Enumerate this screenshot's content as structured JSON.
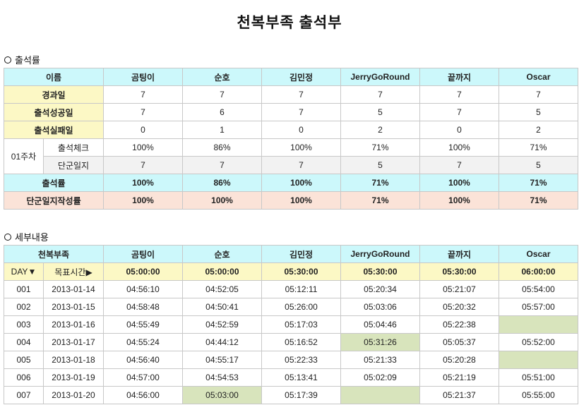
{
  "title": "천복부족 출석부",
  "summary": {
    "section_title": "출석률",
    "name_label": "이름",
    "members": [
      "곰팅이",
      "순호",
      "김민정",
      "JerryGoRound",
      "끝까지",
      "Oscar"
    ],
    "elapsed_label": "경과일",
    "elapsed": [
      "7",
      "7",
      "7",
      "7",
      "7",
      "7"
    ],
    "success_label": "출석성공일",
    "success": [
      "7",
      "6",
      "7",
      "5",
      "7",
      "5"
    ],
    "fail_label": "출석실패일",
    "fail": [
      "0",
      "1",
      "0",
      "2",
      "0",
      "2"
    ],
    "week_label": "01주차",
    "check_label": "출석체크",
    "check": [
      "100%",
      "86%",
      "100%",
      "71%",
      "100%",
      "71%"
    ],
    "diary_label": "단군일지",
    "diary": [
      "7",
      "7",
      "7",
      "5",
      "7",
      "5"
    ],
    "rate_label": "출석률",
    "rate": [
      "100%",
      "86%",
      "100%",
      "71%",
      "100%",
      "71%"
    ],
    "diary_rate_label": "단군일지작성률",
    "diary_rate": [
      "100%",
      "100%",
      "100%",
      "71%",
      "100%",
      "71%"
    ]
  },
  "detail": {
    "section_title": "세부내용",
    "tribe_label": "천복부족",
    "day_label": "DAY▼",
    "target_label": "목표시간▶",
    "targets": [
      "05:00:00",
      "05:00:00",
      "05:30:00",
      "05:30:00",
      "05:30:00",
      "06:00:00"
    ],
    "rows": [
      {
        "day": "001",
        "date": "2013-01-14",
        "times": [
          "04:56:10",
          "04:52:05",
          "05:12:11",
          "05:20:34",
          "05:21:07",
          "05:54:00"
        ],
        "missed": [
          false,
          false,
          false,
          false,
          false,
          false
        ]
      },
      {
        "day": "002",
        "date": "2013-01-15",
        "times": [
          "04:58:48",
          "04:50:41",
          "05:26:00",
          "05:03:06",
          "05:20:32",
          "05:57:00"
        ],
        "missed": [
          false,
          false,
          false,
          false,
          false,
          false
        ]
      },
      {
        "day": "003",
        "date": "2013-01-16",
        "times": [
          "04:55:49",
          "04:52:59",
          "05:17:03",
          "05:04:46",
          "05:22:38",
          ""
        ],
        "missed": [
          false,
          false,
          false,
          false,
          false,
          true
        ]
      },
      {
        "day": "004",
        "date": "2013-01-17",
        "times": [
          "04:55:24",
          "04:44:12",
          "05:16:52",
          "05:31:26",
          "05:05:37",
          "05:52:00"
        ],
        "missed": [
          false,
          false,
          false,
          true,
          false,
          false
        ]
      },
      {
        "day": "005",
        "date": "2013-01-18",
        "times": [
          "04:56:40",
          "04:55:17",
          "05:22:33",
          "05:21:33",
          "05:20:28",
          ""
        ],
        "missed": [
          false,
          false,
          false,
          false,
          false,
          true
        ]
      },
      {
        "day": "006",
        "date": "2013-01-19",
        "times": [
          "04:57:00",
          "04:54:53",
          "05:13:41",
          "05:02:09",
          "05:21:19",
          "05:51:00"
        ],
        "missed": [
          false,
          false,
          false,
          false,
          false,
          false
        ]
      },
      {
        "day": "007",
        "date": "2013-01-20",
        "times": [
          "04:56:00",
          "05:03:00",
          "05:17:39",
          "",
          "05:21:37",
          "05:55:00"
        ],
        "missed": [
          false,
          true,
          false,
          true,
          false,
          false
        ]
      }
    ]
  },
  "colors": {
    "header_cyan": "#ccf8fb",
    "label_yellow": "#fcf8c5",
    "diary_rate_peach": "#fbe3d8",
    "missed_green": "#d8e4bc"
  }
}
